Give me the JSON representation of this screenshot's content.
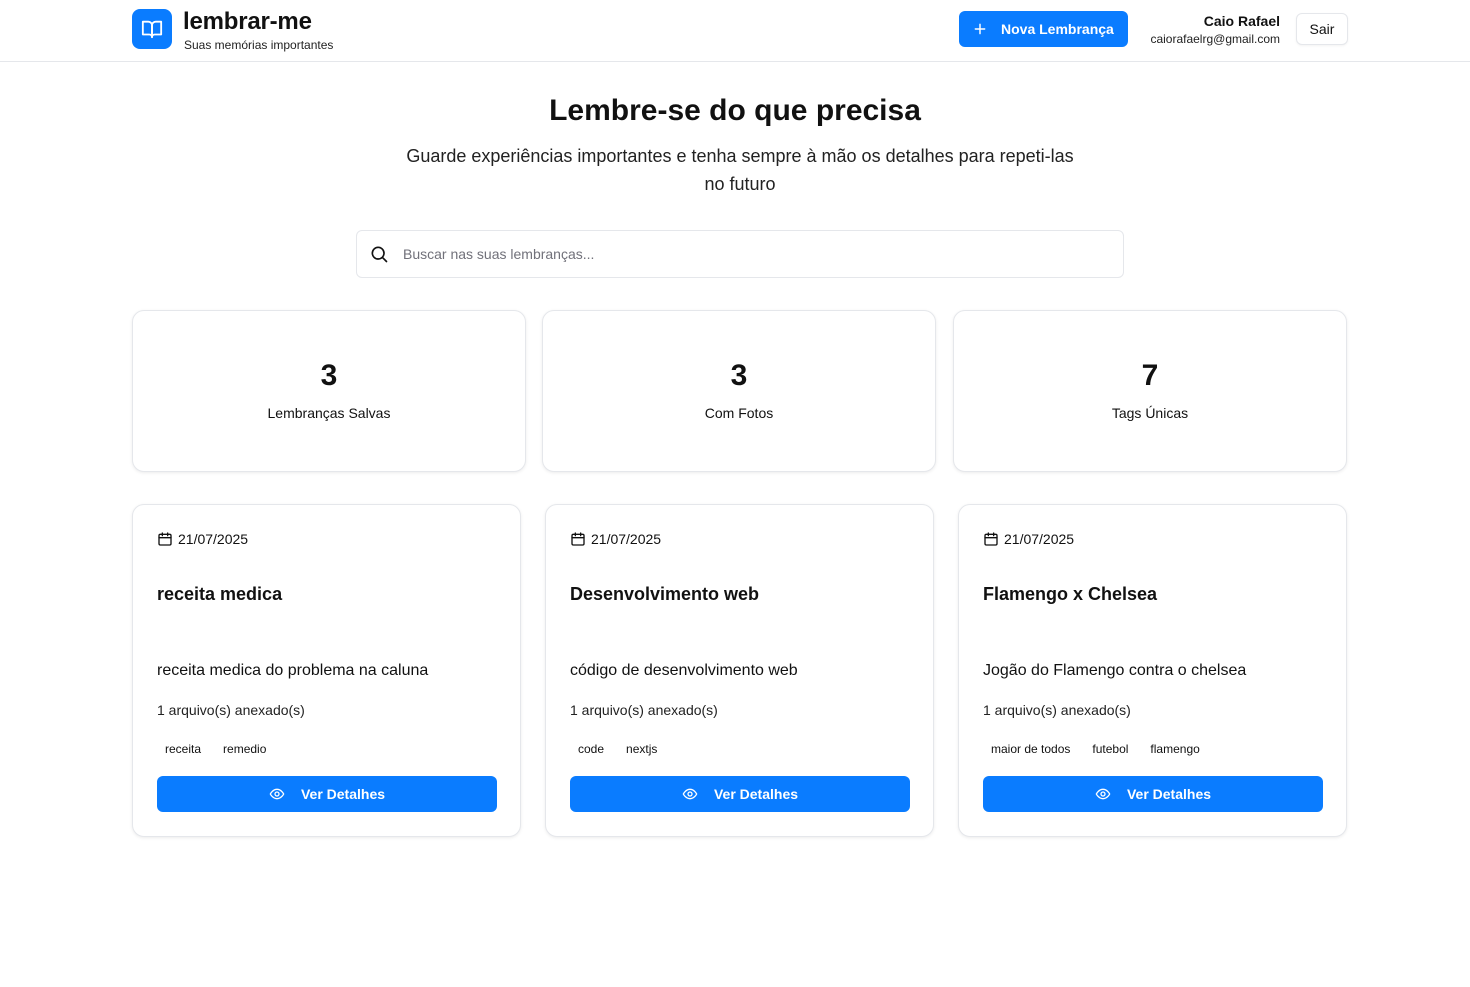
{
  "header": {
    "app_name": "lembrar-me",
    "tagline": "Suas memórias importantes",
    "new_button_label": "Nova Lembrança",
    "user_name": "Caio Rafael",
    "user_email": "caiorafaelrg@gmail.com",
    "logout_label": "Sair",
    "logo_icon": "book-open-icon",
    "accent_color": "#0a7cff"
  },
  "hero": {
    "title": "Lembre-se do que precisa",
    "subtitle": "Guarde experiências importantes e tenha sempre à mão os detalhes para repeti-las no futuro"
  },
  "search": {
    "placeholder": "Buscar nas suas lembranças...",
    "value": "",
    "icon": "search-icon"
  },
  "stats": [
    {
      "value": "3",
      "label": "Lembranças Salvas"
    },
    {
      "value": "3",
      "label": "Com Fotos"
    },
    {
      "value": "7",
      "label": "Tags Únicas"
    }
  ],
  "memories": [
    {
      "date": "21/07/2025",
      "title": "receita medica",
      "description": "receita medica do problema na caluna",
      "files": "1 arquivo(s) anexado(s)",
      "tags": [
        "receita",
        "remedio"
      ],
      "button_label": "Ver Detalhes"
    },
    {
      "date": "21/07/2025",
      "title": "Desenvolvimento web",
      "description": "código de desenvolvimento web",
      "files": "1 arquivo(s) anexado(s)",
      "tags": [
        "code",
        "nextjs"
      ],
      "button_label": "Ver Detalhes"
    },
    {
      "date": "21/07/2025",
      "title": "Flamengo x Chelsea",
      "description": "Jogão do Flamengo contra o chelsea",
      "files": "1 arquivo(s) anexado(s)",
      "tags": [
        "maior de todos",
        "futebol",
        "flamengo"
      ],
      "button_label": "Ver Detalhes"
    }
  ]
}
